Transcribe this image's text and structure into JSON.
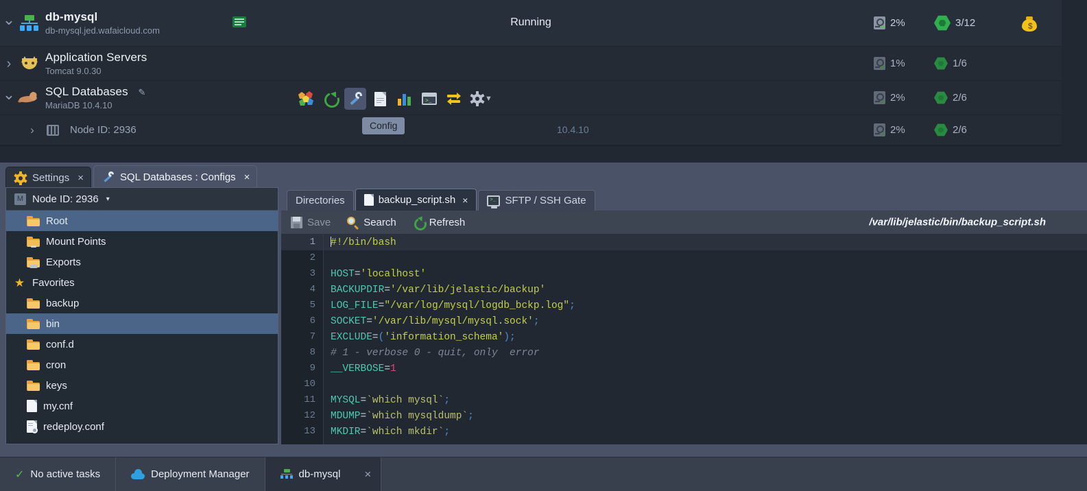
{
  "environment": {
    "name": "db-mysql",
    "domain": "db-mysql.jed.wafaicloud.com",
    "status": "Running",
    "disk_percent": "2%",
    "cloudlets": "3/12",
    "expand_caret": "down",
    "icons": {
      "env": "environment-icon",
      "ssl": "ssl-badge-icon",
      "billing": "money-bag-icon"
    }
  },
  "layers": [
    {
      "title": "Application Servers",
      "sub": "Tomcat 9.0.30",
      "caret": "right",
      "disk_percent": "1%",
      "cloudlets": "1/6",
      "icon": "tomcat-cat-icon"
    },
    {
      "title": "SQL Databases",
      "sub": "MariaDB 10.4.10",
      "caret": "down",
      "disk_percent": "2%",
      "cloudlets": "2/6",
      "icon": "mariadb-seal-icon"
    }
  ],
  "node": {
    "label": "Node ID: 2936",
    "ip": "10.4.10",
    "disk_percent": "2%",
    "cloudlets": "2/6",
    "caret": "right"
  },
  "layer_toolbar": {
    "tooltip": "Config",
    "buttons": [
      {
        "name": "phpmyadmin-icon",
        "title": "Open in Browser"
      },
      {
        "name": "restart-icon",
        "title": "Restart Nodes"
      },
      {
        "name": "wrench-icon",
        "title": "Config",
        "active": true
      },
      {
        "name": "log-document-icon",
        "title": "Log"
      },
      {
        "name": "statistics-icon",
        "title": "Statistics"
      },
      {
        "name": "terminal-icon",
        "title": "Web SSH"
      },
      {
        "name": "redeploy-swap-icon",
        "title": "Redeploy Containers"
      },
      {
        "name": "gear-icon",
        "title": "Additionally"
      }
    ]
  },
  "panel_tabs": [
    {
      "label": "Settings",
      "icon": "settings-gear-icon",
      "active": false,
      "close": "×"
    },
    {
      "label": "SQL Databases : Configs",
      "icon": "wrench-icon",
      "active": true,
      "close": "×"
    }
  ],
  "file_panel": {
    "header": {
      "badge": "M",
      "label": "Node ID: 2936",
      "caret": "▾"
    },
    "items": [
      {
        "label": "Root",
        "icon": "folder-icon",
        "selected": true,
        "group": false
      },
      {
        "label": "Mount Points",
        "icon": "folder-mount-icon",
        "selected": false,
        "group": false
      },
      {
        "label": "Exports",
        "icon": "folder-export-icon",
        "selected": false,
        "group": false
      },
      {
        "label": "Favorites",
        "icon": "star-icon",
        "selected": false,
        "group": true
      },
      {
        "label": "backup",
        "icon": "folder-icon",
        "selected": false,
        "group": false
      },
      {
        "label": "bin",
        "icon": "folder-icon",
        "selected": true,
        "group": false
      },
      {
        "label": "conf.d",
        "icon": "folder-icon",
        "selected": false,
        "group": false
      },
      {
        "label": "cron",
        "icon": "folder-icon",
        "selected": false,
        "group": false
      },
      {
        "label": "keys",
        "icon": "folder-icon",
        "selected": false,
        "group": false
      },
      {
        "label": "my.cnf",
        "icon": "file-icon",
        "selected": false,
        "group": false
      },
      {
        "label": "redeploy.conf",
        "icon": "file-config-icon",
        "selected": false,
        "group": false
      }
    ]
  },
  "editor": {
    "tabs": [
      {
        "label": "Directories",
        "icon": null,
        "active": false,
        "closable": false
      },
      {
        "label": "backup_script.sh",
        "icon": "file-icon",
        "active": true,
        "closable": true,
        "close": "×"
      },
      {
        "label": "SFTP / SSH Gate",
        "icon": "sftp-terminal-icon",
        "active": false,
        "closable": false
      }
    ],
    "toolbar": {
      "save": "Save",
      "save_disabled": true,
      "search": "Search",
      "refresh": "Refresh"
    },
    "file_path": "/var/lib/jelastic/bin/backup_script.sh",
    "current_line": 1,
    "lines": [
      {
        "n": 1,
        "tokens": [
          {
            "t": "#!/bin/bash",
            "c": "tk-plain"
          }
        ]
      },
      {
        "n": 2,
        "tokens": []
      },
      {
        "n": 3,
        "tokens": [
          {
            "t": "HOST",
            "c": "tk-var"
          },
          {
            "t": "=",
            "c": ""
          },
          {
            "t": "'localhost'",
            "c": "tk-str"
          }
        ]
      },
      {
        "n": 4,
        "tokens": [
          {
            "t": "BACKUPDIR",
            "c": "tk-var"
          },
          {
            "t": "=",
            "c": ""
          },
          {
            "t": "'/var/lib/jelastic/backup'",
            "c": "tk-str"
          }
        ]
      },
      {
        "n": 5,
        "tokens": [
          {
            "t": "LOG_FILE",
            "c": "tk-var"
          },
          {
            "t": "=",
            "c": ""
          },
          {
            "t": "\"/var/log/mysql/logdb_bckp.log\"",
            "c": "tk-str"
          },
          {
            "t": ";",
            "c": "tk-punct"
          }
        ]
      },
      {
        "n": 6,
        "tokens": [
          {
            "t": "SOCKET",
            "c": "tk-var"
          },
          {
            "t": "=",
            "c": ""
          },
          {
            "t": "'/var/lib/mysql/mysql.sock'",
            "c": "tk-str"
          },
          {
            "t": ";",
            "c": "tk-punct"
          }
        ]
      },
      {
        "n": 7,
        "tokens": [
          {
            "t": "EXCLUDE",
            "c": "tk-var"
          },
          {
            "t": "=",
            "c": ""
          },
          {
            "t": "(",
            "c": "tk-punct"
          },
          {
            "t": "'information_schema'",
            "c": "tk-str"
          },
          {
            "t": ");",
            "c": "tk-punct"
          }
        ]
      },
      {
        "n": 8,
        "tokens": [
          {
            "t": "# 1 - verbose 0 - quit, only  error",
            "c": "tk-com"
          }
        ]
      },
      {
        "n": 9,
        "tokens": [
          {
            "t": "__VERBOSE",
            "c": "tk-var"
          },
          {
            "t": "=",
            "c": ""
          },
          {
            "t": "1",
            "c": "tk-num"
          }
        ]
      },
      {
        "n": 10,
        "tokens": []
      },
      {
        "n": 11,
        "tokens": [
          {
            "t": "MYSQL",
            "c": "tk-var"
          },
          {
            "t": "=",
            "c": ""
          },
          {
            "t": "`which mysql`",
            "c": "tk-cmd"
          },
          {
            "t": ";",
            "c": "tk-punct"
          }
        ]
      },
      {
        "n": 12,
        "tokens": [
          {
            "t": "MDUMP",
            "c": "tk-var"
          },
          {
            "t": "=",
            "c": ""
          },
          {
            "t": "`which mysqldump`",
            "c": "tk-cmd"
          },
          {
            "t": ";",
            "c": "tk-punct"
          }
        ]
      },
      {
        "n": 13,
        "tokens": [
          {
            "t": "MKDIR",
            "c": "tk-var"
          },
          {
            "t": "=",
            "c": ""
          },
          {
            "t": "`which mkdir`",
            "c": "tk-cmd"
          },
          {
            "t": ";",
            "c": "tk-punct"
          }
        ]
      }
    ]
  },
  "statusbar": {
    "tasks": "No active tasks",
    "tasks_check": "✓",
    "deployment_manager": "Deployment Manager",
    "env_tab": "db-mysql",
    "env_tab_close": "×"
  }
}
